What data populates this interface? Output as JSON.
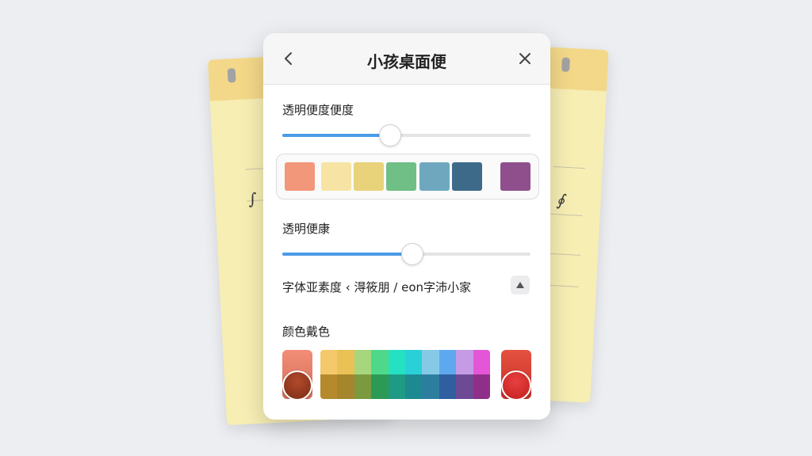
{
  "panel": {
    "title": "小孩桌面便",
    "back_icon": "chevron-left-icon",
    "close_icon": "close-icon"
  },
  "section1": {
    "label": "透明便度便度",
    "slider_value": 0.43
  },
  "palette": {
    "colors": [
      "#f2977a",
      "#f7e4a4",
      "#e8d27a",
      "#6fbf86",
      "#6fa8be",
      "#3e6a8a",
      "#8f4f8c"
    ]
  },
  "section2": {
    "label": "透明便康",
    "slider_value": 0.52
  },
  "font_row": {
    "text": "字体亚素度 ‹ 淂筱朋 / eon字沛小家",
    "up_icon": "arrow-up-icon"
  },
  "section3": {
    "label": "颜色戴色"
  },
  "color_picker": {
    "left_swatch": {
      "top": "#f38d77",
      "bottom": "#d0705a",
      "dot": "#7a2c17"
    },
    "spectrum_top": [
      "#f4c96b",
      "#e9c154",
      "#a7d67d",
      "#4fd88a",
      "#25e0c2",
      "#2ad0d8",
      "#86c9e6",
      "#5ea8ee",
      "#c59be6",
      "#e356d7"
    ],
    "spectrum_bottom": [
      "#b48a2c",
      "#a5862d",
      "#7b9a3f",
      "#2c9a55",
      "#1f9a84",
      "#1d8991",
      "#2d7e9e",
      "#2f5f9f",
      "#6e4a95",
      "#8f2f89"
    ],
    "right_swatch": {
      "top": "#e4513e",
      "bottom": "#c8302a",
      "dot": "#c21f1f"
    }
  }
}
